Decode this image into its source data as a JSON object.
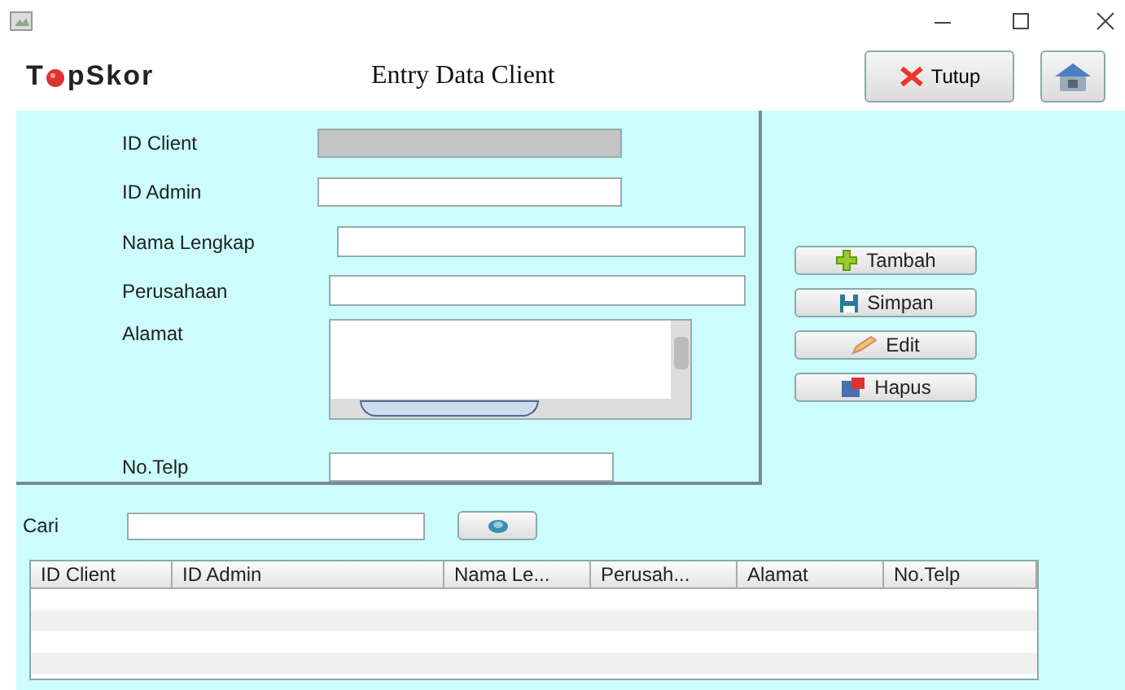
{
  "logo": {
    "before": "T",
    "after": "pSkor"
  },
  "title": "Entry Data Client",
  "close_button": "Tutup",
  "form": [
    {
      "kind": "text",
      "label": "ID Client",
      "disabled": true
    },
    {
      "kind": "text",
      "label": "ID Admin",
      "disabled": false
    },
    {
      "kind": "text",
      "label": "Nama Lengkap",
      "disabled": false
    },
    {
      "kind": "text",
      "label": "Perusahaan",
      "disabled": false
    },
    {
      "kind": "area",
      "label": "Alamat",
      "disabled": false
    },
    {
      "kind": "text",
      "label": "No.Telp",
      "disabled": false
    }
  ],
  "actions": [
    {
      "kind": "add",
      "label": "Tambah"
    },
    {
      "kind": "save",
      "label": "Simpan"
    },
    {
      "kind": "edit",
      "label": "Edit"
    },
    {
      "kind": "delete",
      "label": "Hapus"
    }
  ],
  "search": {
    "label": "Cari"
  },
  "table": {
    "columns": [
      "ID Client",
      "ID Admin",
      "Nama Le...",
      "Perusah...",
      "Alamat",
      "No.Telp"
    ]
  }
}
